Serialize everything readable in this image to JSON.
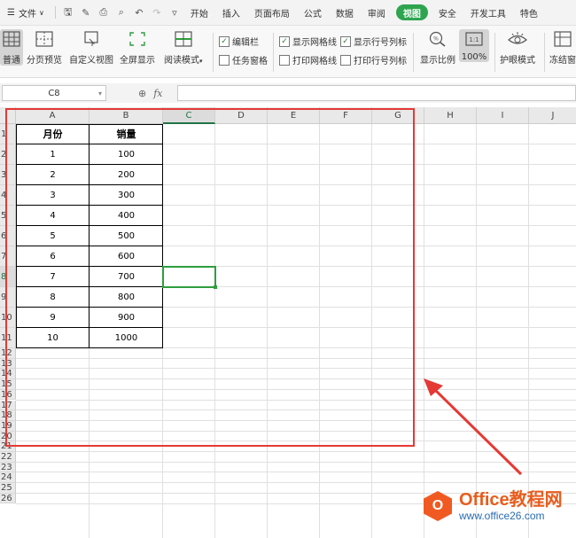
{
  "menu": {
    "file": "文件",
    "tabs": [
      "开始",
      "插入",
      "页面布局",
      "公式",
      "数据",
      "审阅",
      "视图",
      "安全",
      "开发工具",
      "特色"
    ],
    "active_tab": "视图"
  },
  "ribbon": {
    "normal": "普通",
    "page_break_preview": "分页预览",
    "custom_view": "自定义视图",
    "full_screen": "全屏显示",
    "reading_mode": "阅读模式",
    "edit_bar": "编辑栏",
    "task_pane": "任务窗格",
    "show_gridlines": "显示网格线",
    "print_gridlines": "打印网格线",
    "show_headings": "显示行号列标",
    "print_headings": "打印行号列标",
    "zoom_ratio": "显示比例",
    "zoom_100": "100%",
    "eye_protection": "护眼模式",
    "freeze_panes": "冻结窗"
  },
  "formula_bar": {
    "name_box": "C8",
    "fx": "fx",
    "formula": ""
  },
  "columns": [
    "A",
    "B",
    "C",
    "D",
    "E",
    "F",
    "G",
    "H",
    "I",
    "J"
  ],
  "rows": [
    "1",
    "2",
    "3",
    "4",
    "5",
    "6",
    "7",
    "8",
    "9",
    "10",
    "11",
    "12",
    "13",
    "14",
    "15",
    "16",
    "17",
    "18",
    "19",
    "20",
    "21",
    "22",
    "23",
    "24",
    "25",
    "26"
  ],
  "table": {
    "header": [
      "月份",
      "销量"
    ],
    "rows": [
      [
        "1",
        "100"
      ],
      [
        "2",
        "200"
      ],
      [
        "3",
        "300"
      ],
      [
        "4",
        "400"
      ],
      [
        "5",
        "500"
      ],
      [
        "6",
        "600"
      ],
      [
        "7",
        "700"
      ],
      [
        "8",
        "800"
      ],
      [
        "9",
        "900"
      ],
      [
        "10",
        "1000"
      ]
    ]
  },
  "watermark": {
    "brand": "Office教程网",
    "url": "www.office26.com"
  },
  "colors": {
    "active_tab": "#2ea44f",
    "highlight_box": "#e53935",
    "selection": "#2e9e3e",
    "brand_orange": "#f05a22"
  }
}
